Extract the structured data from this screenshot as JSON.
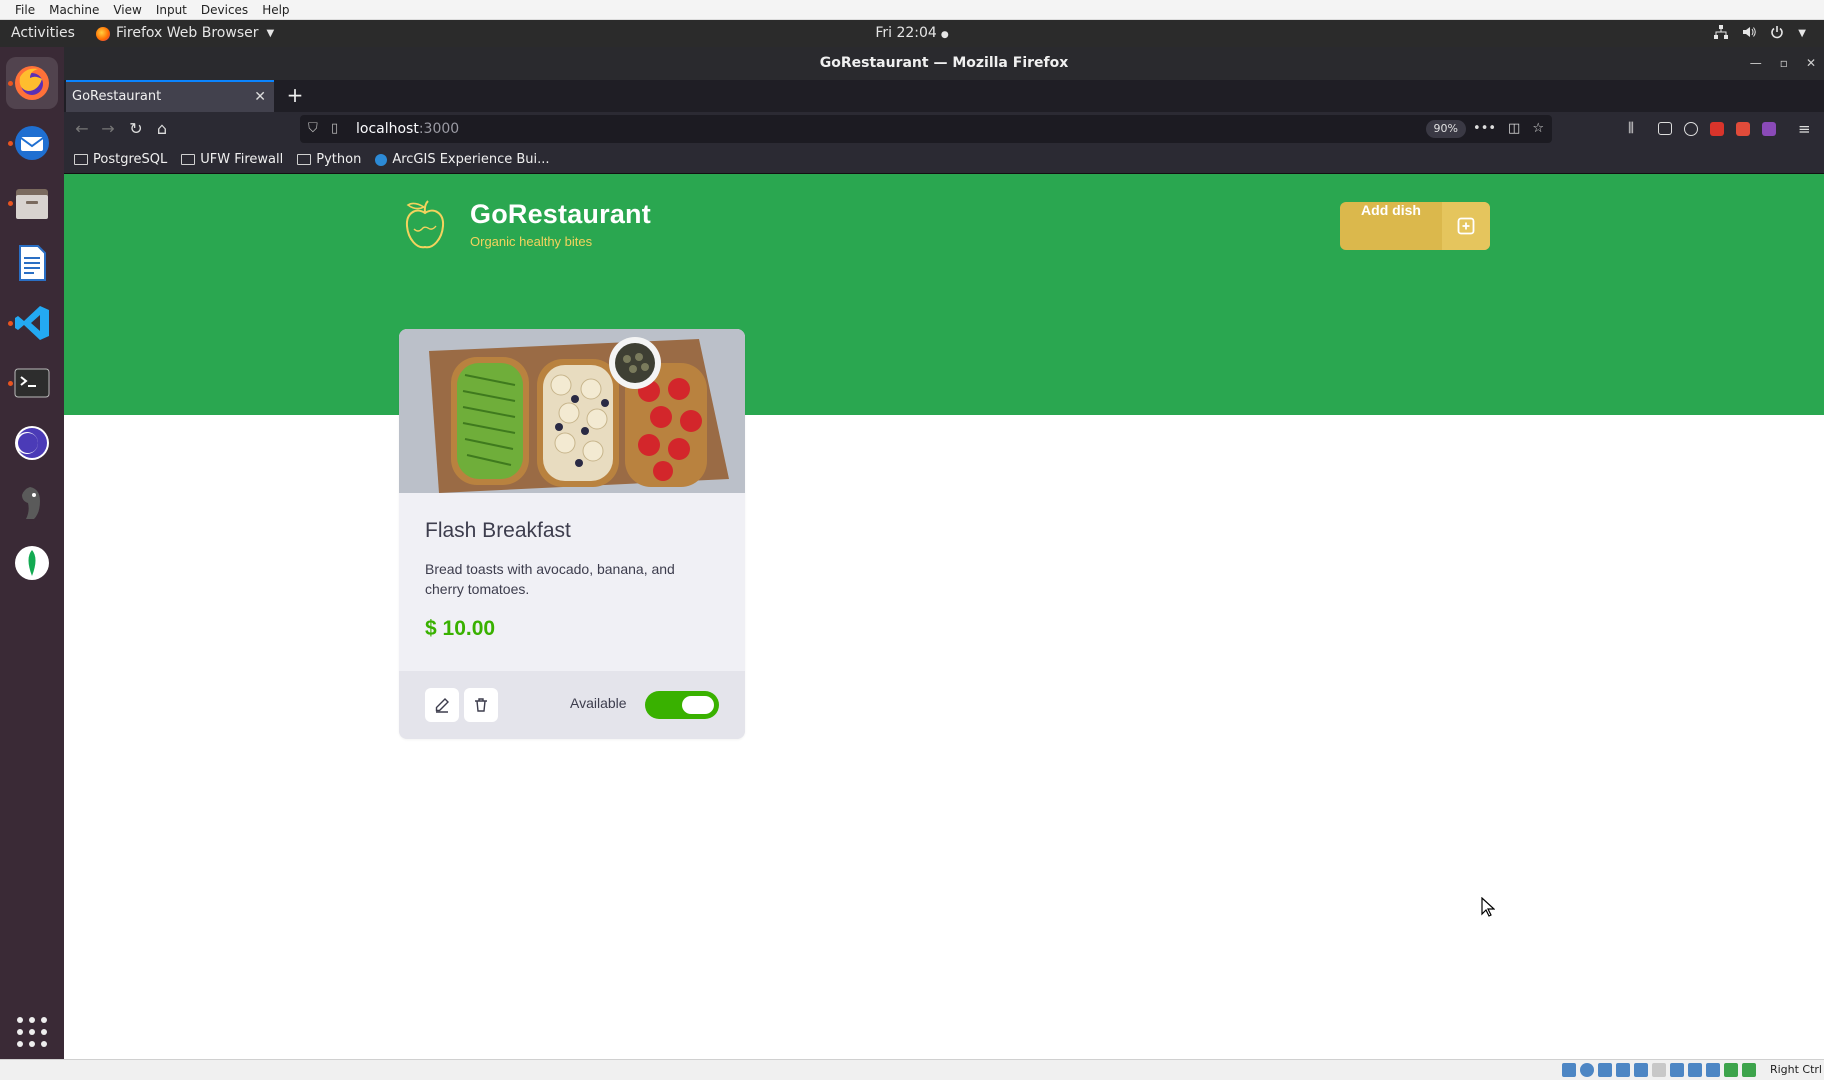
{
  "vbox_menu": [
    "File",
    "Machine",
    "View",
    "Input",
    "Devices",
    "Help"
  ],
  "topbar": {
    "activities": "Activities",
    "app_name": "Firefox Web Browser",
    "clock": "Fri 22:04"
  },
  "dock_icons": [
    "firefox-icon",
    "thunderbird-icon",
    "files-icon",
    "writer-icon",
    "vscode-icon",
    "terminal-icon",
    "eclipse-icon",
    "beekeeper-icon",
    "mongodb-compass-icon"
  ],
  "window": {
    "title": "GoRestaurant — Mozilla Firefox"
  },
  "browser": {
    "tab_title": "GoRestaurant",
    "url_host": "localhost",
    "url_port": ":3000",
    "zoom": "90%",
    "bookmarks": [
      "PostgreSQL",
      "UFW Firewall",
      "Python",
      "ArcGIS Experience Bui..."
    ]
  },
  "app": {
    "title": "GoRestaurant",
    "subtitle": "Organic healthy bites",
    "add_dish_label": "Add dish",
    "colors": {
      "hero": "#2aa750",
      "accent": "#dbb84c",
      "price": "#39b100"
    }
  },
  "dishes": [
    {
      "name": "Flash Breakfast",
      "description": "Bread toasts with avocado, banana, and cherry tomatoes.",
      "price": "$ 10.00",
      "available_label": "Available",
      "available": true
    }
  ],
  "status_bar": {
    "host_key": "Right Ctrl"
  }
}
